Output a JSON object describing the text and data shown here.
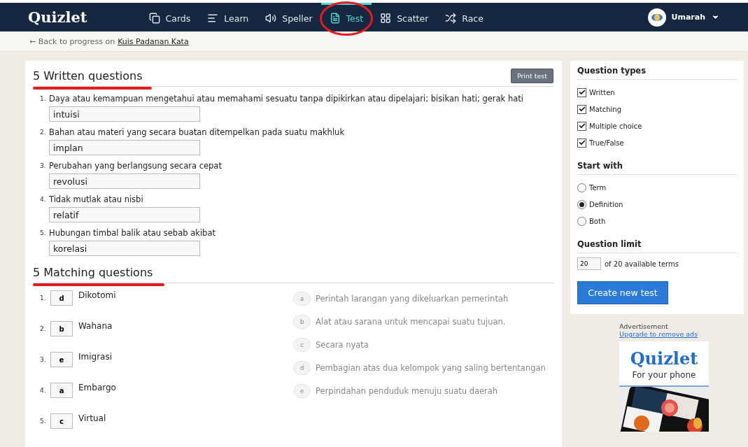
{
  "nav": {
    "logo": "Quizlet",
    "items": [
      {
        "label": "Cards",
        "selected": false,
        "circled": false
      },
      {
        "label": "Learn",
        "selected": false,
        "circled": false
      },
      {
        "label": "Speller",
        "selected": false,
        "circled": false
      },
      {
        "label": "Test",
        "selected": true,
        "circled": true
      },
      {
        "label": "Scatter",
        "selected": false,
        "circled": false
      },
      {
        "label": "Race",
        "selected": false,
        "circled": false
      }
    ],
    "user": "Umarah"
  },
  "breadcrumb": {
    "arrow": "←",
    "prefix": "Back to progress on",
    "link": "Kuis Padanan Kata"
  },
  "written": {
    "title": "5 Written questions",
    "underlined": true,
    "print": "Print test",
    "questions": [
      {
        "number": "1.",
        "prompt": "Daya atau kemampuan mengetahui atau memahami sesuatu tanpa dipikirkan atau dipelajari; bisikan hati; gerak hati",
        "answer": "intuisi"
      },
      {
        "number": "2.",
        "prompt": "Bahan atau materi yang secara buatan ditempelkan pada suatu makhluk",
        "answer": "implan"
      },
      {
        "number": "3.",
        "prompt": "Perubahan yang berlangsung secara cepat",
        "answer": "revolusi"
      },
      {
        "number": "4.",
        "prompt": "Tidak mutlak atau nisbi",
        "answer": "relatif"
      },
      {
        "number": "5.",
        "prompt": "Hubungan timbal balik atau sebab akibat",
        "answer": "korelasi"
      }
    ]
  },
  "matching": {
    "title": "5 Matching questions",
    "underlined": true,
    "terms": [
      {
        "number": "1.",
        "answer": "d",
        "term": "Dikotomi"
      },
      {
        "number": "2.",
        "answer": "b",
        "term": "Wahana"
      },
      {
        "number": "3.",
        "answer": "e",
        "term": "Imigrasi"
      },
      {
        "number": "4.",
        "answer": "a",
        "term": "Embargo"
      },
      {
        "number": "5.",
        "answer": "c",
        "term": "Virtual"
      }
    ],
    "definitions": [
      {
        "letter": "a",
        "text": "Perintah larangan yang dikeluarkan pemerintah"
      },
      {
        "letter": "b",
        "text": "Alat atau sarana untuk mencapai suatu tujuan."
      },
      {
        "letter": "c",
        "text": "Secara nyata"
      },
      {
        "letter": "d",
        "text": "Pembagian atas dua kelompok yang saling bertentangan"
      },
      {
        "letter": "e",
        "text": "Perpindahan penduduk menuju suatu daerah"
      }
    ]
  },
  "sidebar": {
    "types_title": "Question types",
    "types": [
      {
        "label": "Written",
        "checked": true
      },
      {
        "label": "Matching",
        "checked": true
      },
      {
        "label": "Multiple choice",
        "checked": true
      },
      {
        "label": "True/False",
        "checked": true
      }
    ],
    "start_title": "Start with",
    "start": [
      {
        "label": "Term",
        "selected": false
      },
      {
        "label": "Definition",
        "selected": true
      },
      {
        "label": "Both",
        "selected": false
      }
    ],
    "limit_title": "Question limit",
    "limit_value": "20",
    "limit_text": "of 20 available terms",
    "create": "Create new test"
  },
  "ad": {
    "label": "Advertisement",
    "link": "Upgrade to remove ads",
    "logo": "Quizlet",
    "tagline": "For your phone",
    "kind": "picture"
  }
}
